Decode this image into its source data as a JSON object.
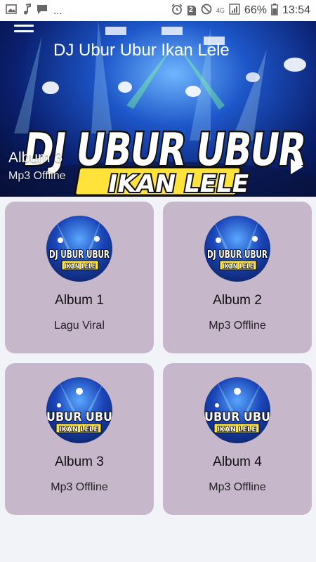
{
  "status_bar": {
    "notifications": "...",
    "sim_badge": "2",
    "network": "4G",
    "battery": "66%",
    "time": "13:54"
  },
  "toolbar": {
    "title": "DJ Ubur Ubur Ikan Lele"
  },
  "hero": {
    "banner_line1": "DJ UBUR UBUR",
    "banner_line2": "IKAN LELE",
    "album": "Album 3",
    "subtitle": "Mp3 Offline"
  },
  "albums": [
    {
      "title": "Album 1",
      "subtitle": "Lagu Viral",
      "cover_line1": "DJ UBUR UBUR",
      "cover_line2": "IKAN LELE"
    },
    {
      "title": "Album 2",
      "subtitle": "Mp3 Offline",
      "cover_line1": "DJ UBUR UBUR",
      "cover_line2": "IKAN LELE"
    },
    {
      "title": "Album 3",
      "subtitle": "Mp3 Offline",
      "cover_line1": "UBUR UBU",
      "cover_line2": "IKAN LELE"
    },
    {
      "title": "Album 4",
      "subtitle": "Mp3 Offline",
      "cover_line1": "UBUR UBU",
      "cover_line2": "IKAN LELE"
    }
  ],
  "icons": {
    "menu": "hamburger-icon",
    "play": "play-icon"
  },
  "colors": {
    "card_bg": "#c6b7cb",
    "page_bg": "#f2f3f8"
  }
}
